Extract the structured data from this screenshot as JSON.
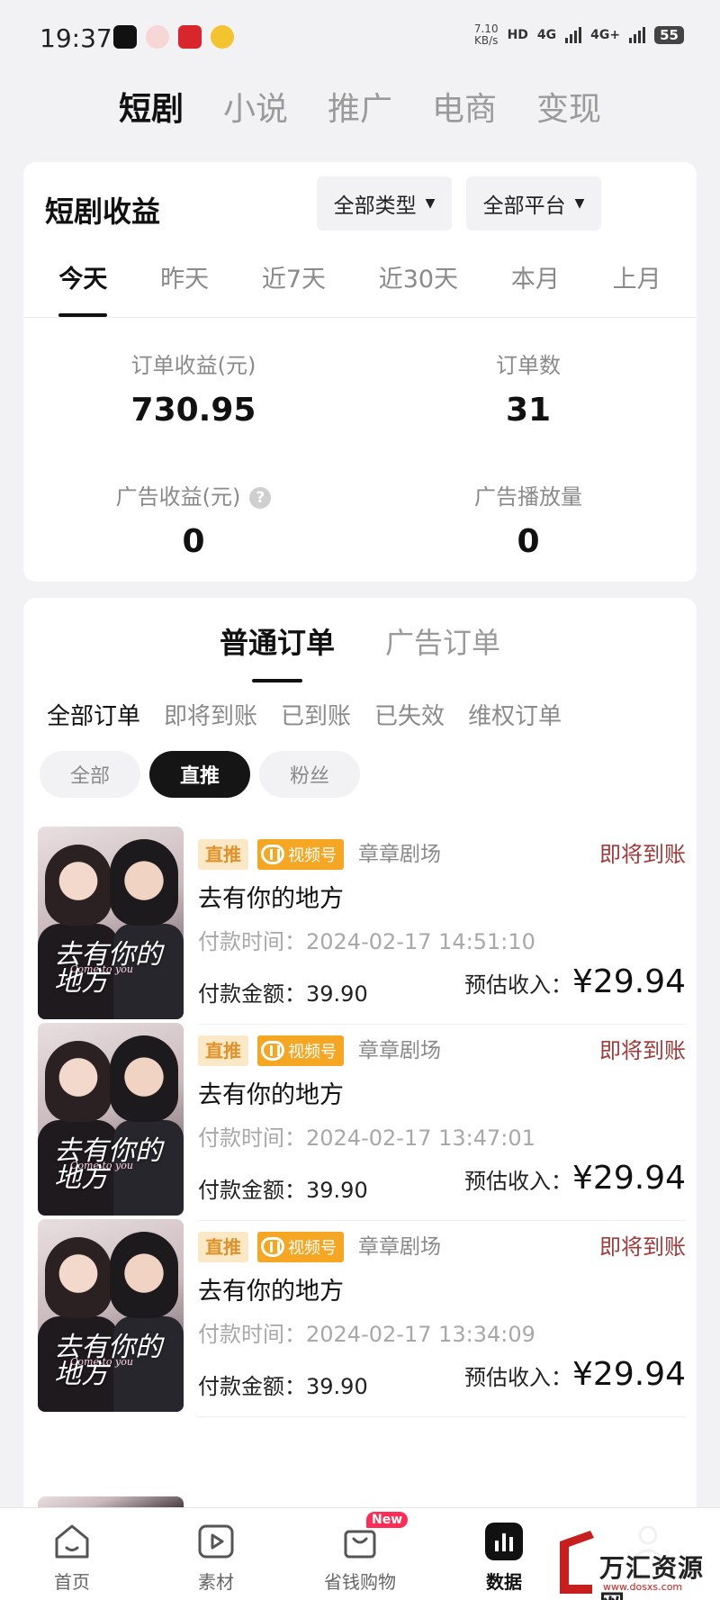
{
  "status_bar": {
    "time": "19:37",
    "speed_value": "7.10",
    "speed_unit": "KB/s",
    "hd": "HD",
    "net1": "4G",
    "net2": "4G+",
    "battery": "55"
  },
  "top_tabs": [
    {
      "label": "短剧",
      "active": true
    },
    {
      "label": "小说",
      "active": false
    },
    {
      "label": "推广",
      "active": false
    },
    {
      "label": "电商",
      "active": false
    },
    {
      "label": "变现",
      "active": false
    }
  ],
  "earnings": {
    "title": "短剧收益",
    "type_filter": "全部类型",
    "platform_filter": "全部平台",
    "periods": [
      "今天",
      "昨天",
      "近7天",
      "近30天",
      "本月",
      "上月"
    ],
    "active_period": "今天",
    "order_income_label": "订单收益(元)",
    "order_income_value": "730.95",
    "order_count_label": "订单数",
    "order_count_value": "31",
    "ad_income_label": "广告收益(元)",
    "ad_income_value": "0",
    "ad_plays_label": "广告播放量",
    "ad_plays_value": "0"
  },
  "orders": {
    "tabs": [
      "普通订单",
      "广告订单"
    ],
    "status_filters": [
      "全部订单",
      "即将到账",
      "已到账",
      "已失效",
      "维权订单"
    ],
    "chips": [
      "全部",
      "直推",
      "粉丝"
    ],
    "items": [
      {
        "tag": "直推",
        "channel": "视频号",
        "theater": "章章剧场",
        "status": "即将到账",
        "drama": "去有你的地方",
        "pay_time_label": "付款时间：",
        "pay_time": "2024-02-17 14:51:10",
        "amount_label": "付款金额：",
        "amount": "39.90",
        "income_label": "预估收入：",
        "income": "¥29.94",
        "poster_title": "去有你的地方",
        "poster_sub": "Come to you"
      },
      {
        "tag": "直推",
        "channel": "视频号",
        "theater": "章章剧场",
        "status": "即将到账",
        "drama": "去有你的地方",
        "pay_time_label": "付款时间：",
        "pay_time": "2024-02-17 13:47:01",
        "amount_label": "付款金额：",
        "amount": "39.90",
        "income_label": "预估收入：",
        "income": "¥29.94",
        "poster_title": "去有你的地方",
        "poster_sub": "Come to you"
      },
      {
        "tag": "直推",
        "channel": "视频号",
        "theater": "章章剧场",
        "status": "即将到账",
        "drama": "去有你的地方",
        "pay_time_label": "付款时间：",
        "pay_time": "2024-02-17 13:34:09",
        "amount_label": "付款金额：",
        "amount": "39.90",
        "income_label": "预估收入：",
        "income": "¥29.94",
        "poster_title": "去有你的地方",
        "poster_sub": "Come to you"
      }
    ]
  },
  "bottom_nav": [
    {
      "label": "首页",
      "icon": "home-icon"
    },
    {
      "label": "素材",
      "icon": "play-icon"
    },
    {
      "label": "省钱购物",
      "icon": "shopping-bag-icon",
      "badge": "New"
    },
    {
      "label": "数据",
      "icon": "bar-chart-icon",
      "active": true
    },
    {
      "label": "我的",
      "icon": "profile-icon"
    }
  ],
  "watermark": {
    "text": "万汇资源网",
    "url": "www.dosxs.com"
  },
  "colors": {
    "accent_dark": "#151515",
    "status_red": "#a33a3a",
    "tag_orange": "#f5a623",
    "badge_red": "#ff2d55"
  }
}
